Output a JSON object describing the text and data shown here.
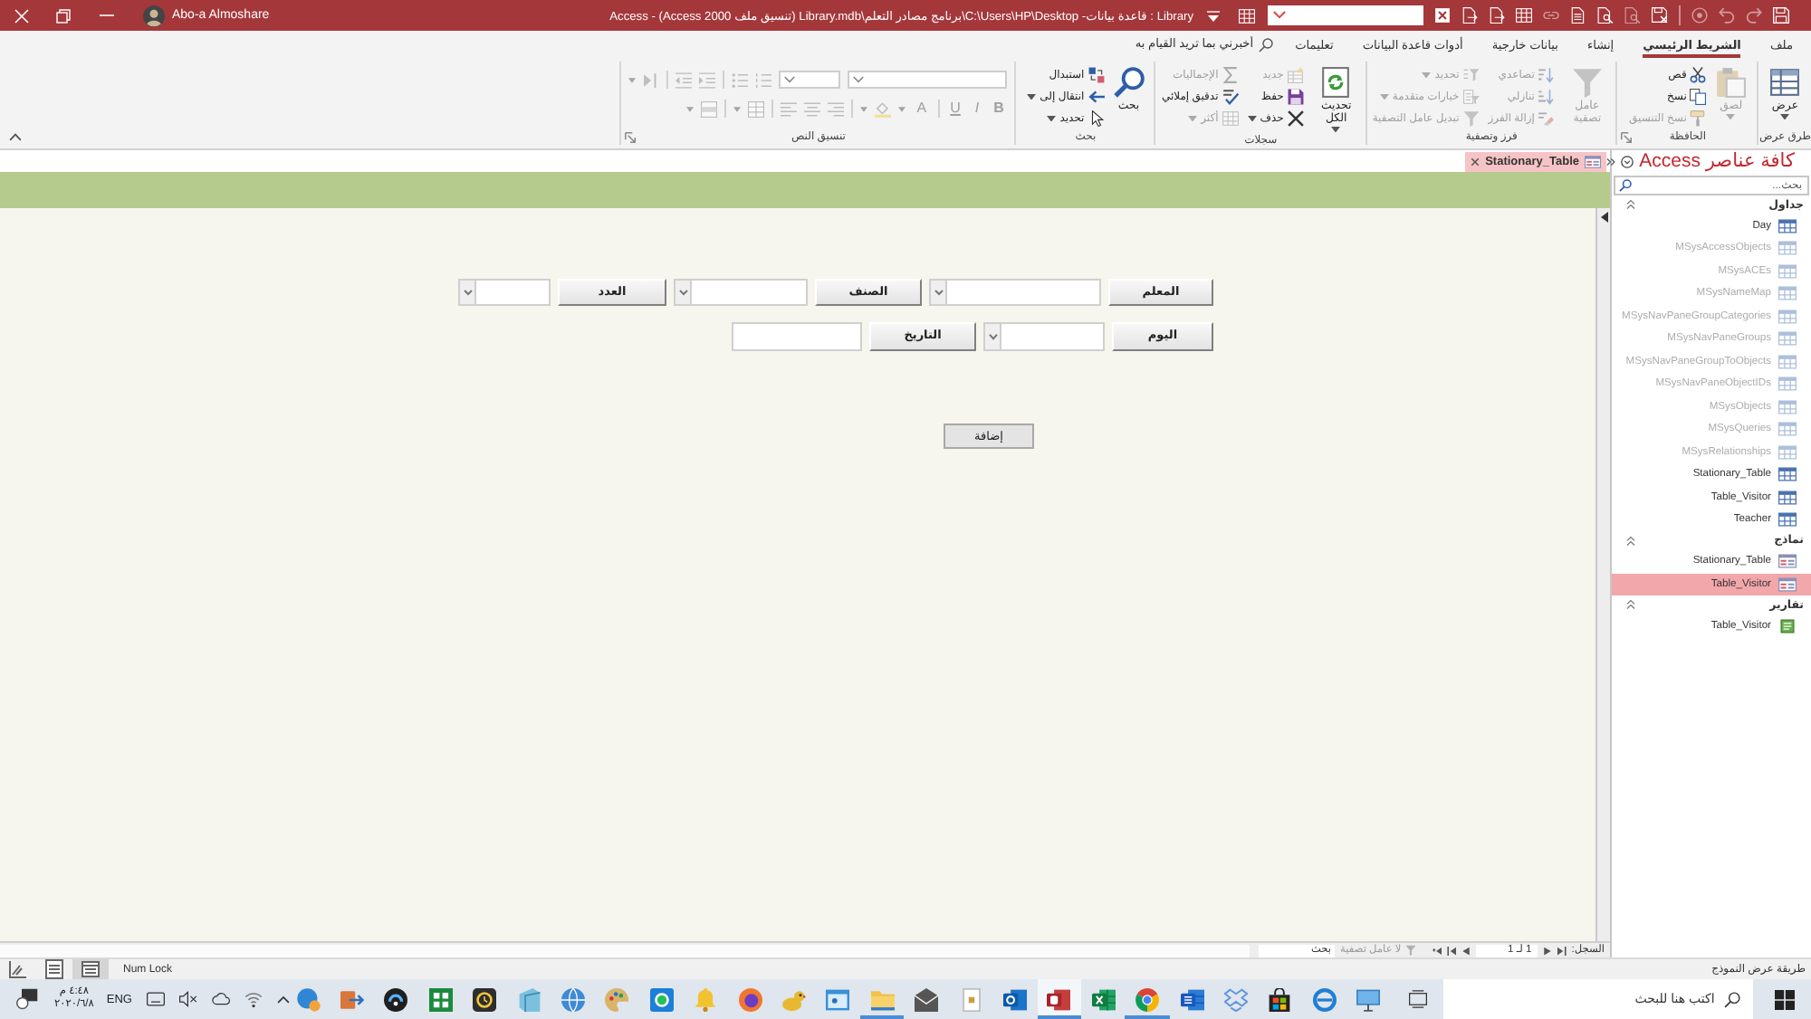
{
  "title_bar": {
    "user": "Abo-a Almoshare",
    "title": "Library : قاعدة بيانات- C:\\Users\\HP\\Desktop\\برنامج مصادر التعلم\\Library.mdb (تنسيق ملف Access 2000) - Access"
  },
  "ribbon_tabs": [
    {
      "label": "ملف",
      "selected": false
    },
    {
      "label": "الشريط الرئيسي",
      "selected": true
    },
    {
      "label": "إنشاء",
      "selected": false
    },
    {
      "label": "بيانات خارجية",
      "selected": false
    },
    {
      "label": "أدوات قاعدة البيانات",
      "selected": false
    },
    {
      "label": "تعليمات",
      "selected": false
    }
  ],
  "tell_me": {
    "placeholder": "أخبرني بما تريد القيام به"
  },
  "ribbon_groups": [
    {
      "label": "طرق عرض",
      "kind": "buttons",
      "buttons": [
        {
          "label": "عرض",
          "kind": "large-menu",
          "disabled": false
        }
      ]
    },
    {
      "label": "الحافظة",
      "kind": "buttons",
      "buttons": [
        {
          "label": "لصق",
          "kind": "large-menu",
          "disabled": true
        },
        {
          "label": "قص",
          "kind": "small",
          "disabled": false
        },
        {
          "label": "نسخ",
          "kind": "small",
          "disabled": false
        },
        {
          "label": "نسخ التنسيق",
          "kind": "small",
          "disabled": true
        }
      ]
    },
    {
      "label": "فرز وتصفية",
      "kind": "buttons",
      "buttons": [
        {
          "label": "عامل تصفية",
          "kind": "large",
          "disabled": true
        },
        {
          "label": "تصاعدي",
          "kind": "small",
          "disabled": true
        },
        {
          "label": "تنازلي",
          "kind": "small",
          "disabled": true
        },
        {
          "label": "إزالة الفرز",
          "kind": "small",
          "disabled": true
        },
        {
          "label": "تحديد",
          "kind": "small-menu",
          "disabled": true
        },
        {
          "label": "خيارات متقدمة",
          "kind": "small-menu",
          "disabled": true
        },
        {
          "label": "تبديل عامل التصفية",
          "kind": "small",
          "disabled": true
        }
      ]
    },
    {
      "label": "سجلات",
      "kind": "buttons",
      "buttons": [
        {
          "label": "تحديث الكل",
          "kind": "large-menu",
          "disabled": false
        },
        {
          "label": "جديد",
          "kind": "small",
          "disabled": true
        },
        {
          "label": "حفظ",
          "kind": "small",
          "disabled": false
        },
        {
          "label": "حذف",
          "kind": "small-menu",
          "disabled": false
        },
        {
          "label": "الإجماليات",
          "kind": "small",
          "disabled": true
        },
        {
          "label": "تدقيق إملائي",
          "kind": "small",
          "disabled": false
        },
        {
          "label": "أكثر",
          "kind": "small-menu",
          "disabled": true
        }
      ]
    },
    {
      "label": "بحث",
      "kind": "buttons",
      "buttons": [
        {
          "label": "بحث",
          "kind": "large",
          "disabled": false
        },
        {
          "label": "استبدال",
          "kind": "small",
          "disabled": false
        },
        {
          "label": "انتقال إلى",
          "kind": "small-menu",
          "disabled": false
        },
        {
          "label": "تحديد",
          "kind": "small-menu",
          "disabled": false
        }
      ]
    },
    {
      "label": "تنسيق النص",
      "kind": "format",
      "buttons": [
        {
          "label": "B",
          "disabled": true
        },
        {
          "label": "I",
          "disabled": true
        },
        {
          "label": "U",
          "disabled": true
        },
        {
          "label": "A",
          "disabled": true
        }
      ]
    }
  ],
  "document_tab": {
    "label": "Stationary_Table",
    "selected": true
  },
  "form": {
    "rows": [
      [
        {
          "label": "المعلم",
          "kind": "combo"
        },
        {
          "label": "الصنف",
          "kind": "combo"
        },
        {
          "label": "العدد",
          "kind": "combo"
        }
      ],
      [
        {
          "label": "اليوم",
          "kind": "combo"
        },
        {
          "label": "التاريخ",
          "kind": "text"
        }
      ]
    ],
    "button": "إضافة"
  },
  "record_navigator": {
    "label": "السجل:",
    "position": "1 لـ 1",
    "filter": "لا عامل تصفية",
    "search_placeholder": "بحث"
  },
  "nav_pane": {
    "title": "كافة عناصر Access",
    "search_placeholder": "بحث...",
    "groups": [
      {
        "title": "جداول",
        "kind": "table",
        "expanded": true,
        "items": [
          {
            "name": "Day",
            "disabled": false,
            "selected": false
          },
          {
            "name": "MSysAccessObjects",
            "disabled": true,
            "selected": false
          },
          {
            "name": "MSysACEs",
            "disabled": true,
            "selected": false
          },
          {
            "name": "MSysNameMap",
            "disabled": true,
            "selected": false
          },
          {
            "name": "MSysNavPaneGroupCategories",
            "disabled": true,
            "selected": false
          },
          {
            "name": "MSysNavPaneGroups",
            "disabled": true,
            "selected": false
          },
          {
            "name": "MSysNavPaneGroupToObjects",
            "disabled": true,
            "selected": false
          },
          {
            "name": "MSysNavPaneObjectIDs",
            "disabled": true,
            "selected": false
          },
          {
            "name": "MSysObjects",
            "disabled": true,
            "selected": false
          },
          {
            "name": "MSysQueries",
            "disabled": true,
            "selected": false
          },
          {
            "name": "MSysRelationships",
            "disabled": true,
            "selected": false
          },
          {
            "name": "Stationary_Table",
            "disabled": false,
            "selected": false
          },
          {
            "name": "Table_Visitor",
            "disabled": false,
            "selected": false
          },
          {
            "name": "Teacher",
            "disabled": false,
            "selected": false
          }
        ]
      },
      {
        "title": "نماذج",
        "kind": "form",
        "expanded": true,
        "items": [
          {
            "name": "Stationary_Table",
            "disabled": false,
            "selected": false
          },
          {
            "name": "Table_Visitor",
            "disabled": false,
            "selected": true
          }
        ]
      },
      {
        "title": "تقارير",
        "kind": "report",
        "expanded": true,
        "items": [
          {
            "name": "Table_Visitor",
            "disabled": false,
            "selected": false
          }
        ]
      }
    ]
  },
  "status_bar": {
    "views": [
      {
        "selected": false
      },
      {
        "selected": false
      },
      {
        "selected": true
      }
    ],
    "left": "Num Lock",
    "right": "طريقة عرض النموذج"
  },
  "taskbar": {
    "time": "٤:٤٨ م",
    "date": "٢٠٢٠/٦/٨",
    "language": "ENG",
    "search_placeholder": "اكتب هنا للبحث",
    "apps": [
      {
        "open": false,
        "selected": false
      },
      {
        "open": false,
        "selected": false
      },
      {
        "open": false,
        "selected": false
      },
      {
        "open": false,
        "selected": false
      },
      {
        "open": false,
        "selected": false
      },
      {
        "open": false,
        "selected": false
      },
      {
        "open": false,
        "selected": false
      },
      {
        "open": false,
        "selected": false
      },
      {
        "open": false,
        "selected": false
      },
      {
        "open": false,
        "selected": false
      },
      {
        "open": false,
        "selected": false
      },
      {
        "open": false,
        "selected": false
      },
      {
        "open": false,
        "selected": false
      },
      {
        "open": true,
        "selected": false
      },
      {
        "open": false,
        "selected": false
      },
      {
        "open": false,
        "selected": false
      },
      {
        "open": false,
        "selected": false
      },
      {
        "open": true,
        "selected": true
      },
      {
        "open": false,
        "selected": false
      },
      {
        "open": true,
        "selected": false
      },
      {
        "open": false,
        "selected": false
      },
      {
        "open": false,
        "selected": false
      },
      {
        "open": false,
        "selected": false
      },
      {
        "open": false,
        "selected": false
      },
      {
        "open": false,
        "selected": false
      }
    ]
  }
}
